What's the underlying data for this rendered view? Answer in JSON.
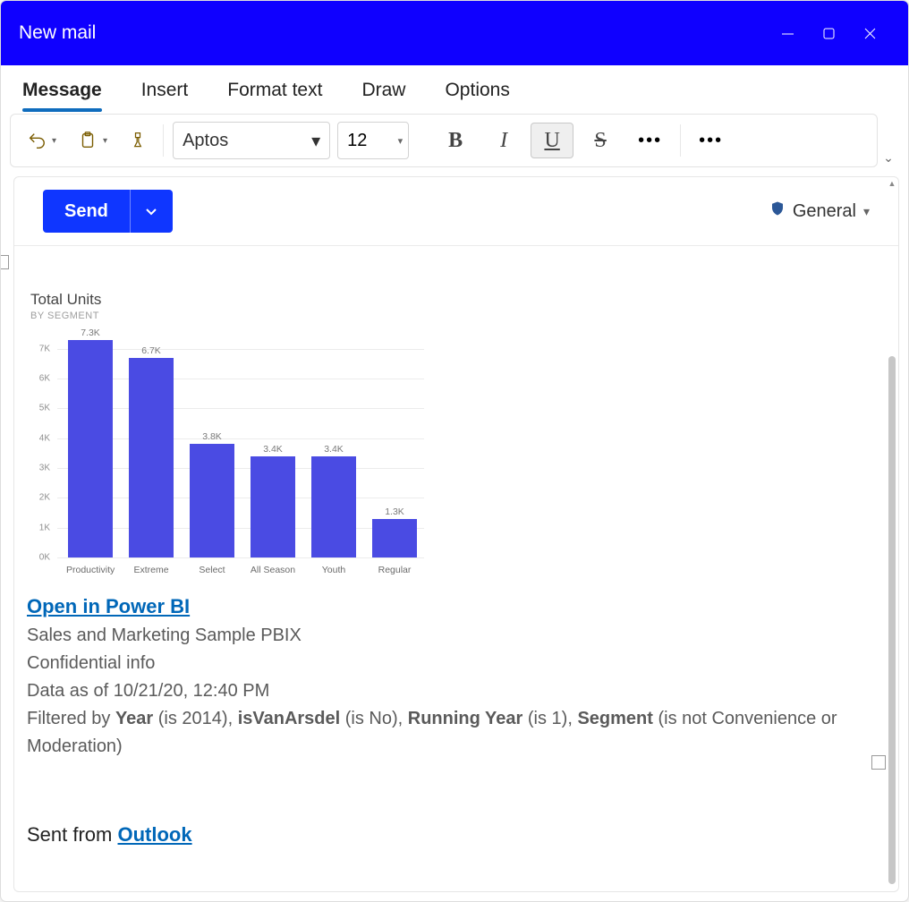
{
  "window": {
    "title": "New mail"
  },
  "tabs": [
    "Message",
    "Insert",
    "Format text",
    "Draw",
    "Options"
  ],
  "toolbar": {
    "font_name": "Aptos",
    "font_size": "12"
  },
  "compose": {
    "send_label": "Send",
    "sensitivity_label": "General"
  },
  "body": {
    "link_text": "Open in Power BI",
    "source": "Sales and Marketing Sample PBIX",
    "classification": "Confidential info",
    "data_as_of_prefix": "Data as of ",
    "data_as_of": "10/21/20, 12:40 PM",
    "filter": {
      "prefix": "Filtered by ",
      "year_key": "Year",
      "year_val": " (is 2014), ",
      "van_key": "isVanArsdel",
      "van_val": " (is No), ",
      "run_key": "Running Year",
      "run_val": " (is 1), ",
      "seg_key": "Segment",
      "seg_val": " (is not Convenience or Moderation)"
    },
    "sig_prefix": "Sent from ",
    "sig_link": "Outlook"
  },
  "chart_data": {
    "type": "bar",
    "title": "Total Units",
    "subtitle": "BY SEGMENT",
    "categories": [
      "Productivity",
      "Extreme",
      "Select",
      "All Season",
      "Youth",
      "Regular"
    ],
    "values": [
      7300,
      6700,
      3800,
      3400,
      3400,
      1300
    ],
    "value_labels": [
      "7.3K",
      "6.7K",
      "3.8K",
      "3.4K",
      "3.4K",
      "1.3K"
    ],
    "ylabel": "",
    "xlabel": "",
    "y_ticks": [
      "0K",
      "1K",
      "2K",
      "3K",
      "4K",
      "5K",
      "6K",
      "7K"
    ],
    "ylim": [
      0,
      7500
    ]
  }
}
